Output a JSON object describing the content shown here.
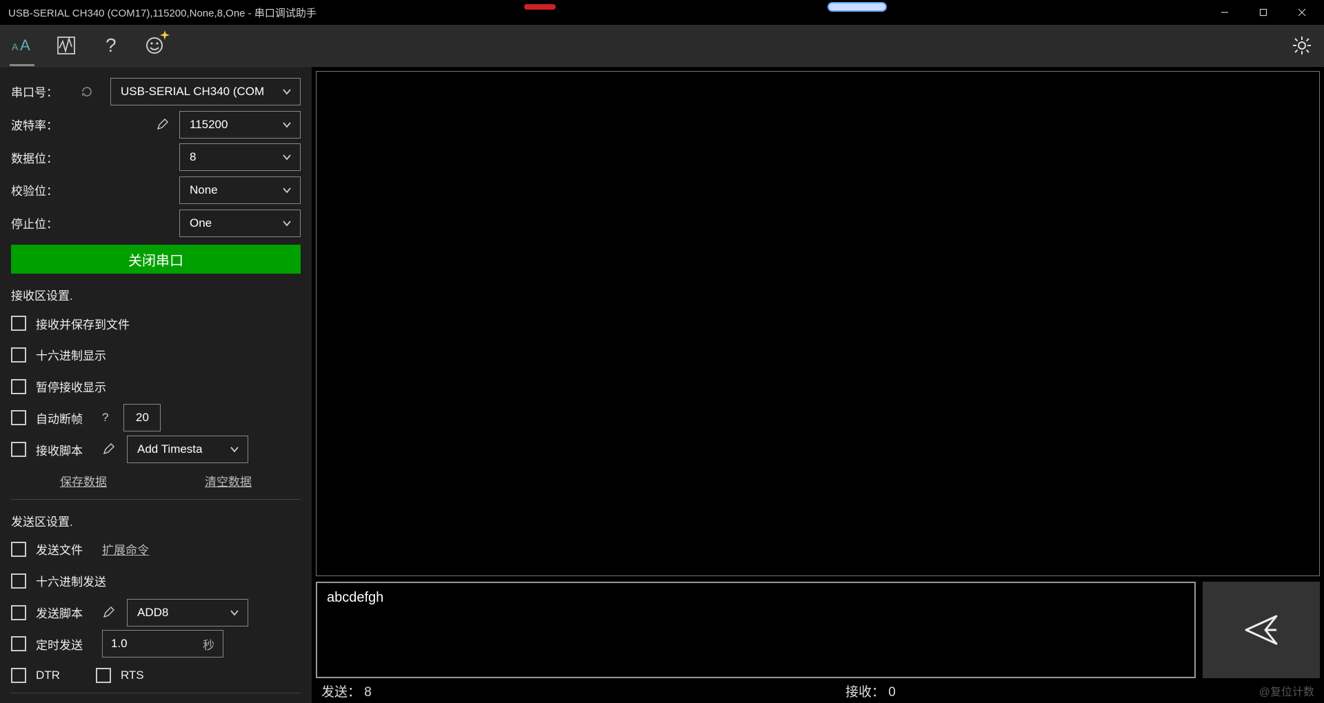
{
  "window": {
    "title": "USB-SERIAL CH340 (COM17),115200,None,8,One - 串口调试助手"
  },
  "serial": {
    "port_label": "串口号：",
    "port_value": "USB-SERIAL CH340 (COM",
    "baud_label": "波特率：",
    "baud_value": "115200",
    "data_label": "数据位：",
    "data_value": "8",
    "parity_label": "校验位：",
    "parity_value": "None",
    "stop_label": "停止位：",
    "stop_value": "One",
    "close_label": "关闭串口"
  },
  "rx_settings": {
    "title": "接收区设置.",
    "save_to_file": "接收并保存到文件",
    "hex_display": "十六进制显示",
    "pause_display": "暂停接收显示",
    "auto_break": "自动断帧",
    "auto_break_help": "?",
    "auto_break_value": "20",
    "rx_script": "接收脚本",
    "rx_script_value": "Add Timesta",
    "save_data": "保存数据",
    "clear_data": "清空数据"
  },
  "tx_settings": {
    "title": "发送区设置.",
    "send_file": "发送文件",
    "ext_cmd": "扩展命令",
    "hex_send": "十六进制发送",
    "tx_script": "发送脚本",
    "tx_script_value": "ADD8",
    "timed_send": "定时发送",
    "timed_value": "1.0",
    "timed_unit": "秒",
    "dtr": "DTR",
    "rts": "RTS"
  },
  "main": {
    "tx_text": "abcdefgh"
  },
  "status": {
    "sent_label": "发送：",
    "sent_value": "8",
    "recv_label": "接收：",
    "recv_value": "0",
    "watermark": "@复位计数"
  }
}
